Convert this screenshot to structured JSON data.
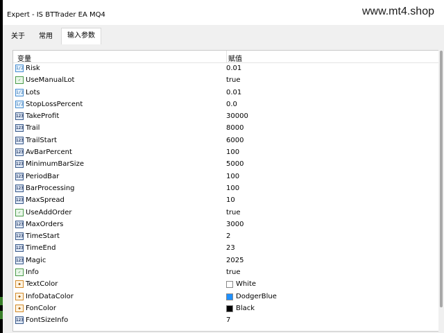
{
  "window": {
    "title": "Expert - IS BTTrader EA MQ4"
  },
  "watermark": "www.mt4.shop",
  "tabs": [
    {
      "label": "关于"
    },
    {
      "label": "常用"
    },
    {
      "label": "输入参数"
    }
  ],
  "grid": {
    "headers": {
      "name": "变量",
      "value": "赋值"
    },
    "rows": [
      {
        "name": "Risk",
        "value": "0.01",
        "type": "float"
      },
      {
        "name": "UseManualLot",
        "value": "true",
        "type": "bool"
      },
      {
        "name": "Lots",
        "value": "0.01",
        "type": "float"
      },
      {
        "name": "StopLossPercent",
        "value": "0.0",
        "type": "float"
      },
      {
        "name": "TakeProfit",
        "value": "30000",
        "type": "int"
      },
      {
        "name": "Trail",
        "value": "8000",
        "type": "int"
      },
      {
        "name": "TrailStart",
        "value": "6000",
        "type": "int"
      },
      {
        "name": "AvBarPercent",
        "value": "100",
        "type": "int"
      },
      {
        "name": "MinimumBarSize",
        "value": "5000",
        "type": "int"
      },
      {
        "name": "PeriodBar",
        "value": "100",
        "type": "int"
      },
      {
        "name": "BarProcessing",
        "value": "100",
        "type": "int"
      },
      {
        "name": "MaxSpread",
        "value": "10",
        "type": "int"
      },
      {
        "name": "UseAddOrder",
        "value": "true",
        "type": "bool"
      },
      {
        "name": "MaxOrders",
        "value": "3000",
        "type": "int"
      },
      {
        "name": "TimeStart",
        "value": "2",
        "type": "int"
      },
      {
        "name": "TimeEnd",
        "value": "23",
        "type": "int"
      },
      {
        "name": "Magic",
        "value": "2025",
        "type": "int"
      },
      {
        "name": "Info",
        "value": "true",
        "type": "bool"
      },
      {
        "name": "TextColor",
        "value": "White",
        "type": "color",
        "swatch": "#ffffff"
      },
      {
        "name": "InfoDataColor",
        "value": "DodgerBlue",
        "type": "color",
        "swatch": "#1e90ff"
      },
      {
        "name": "FonColor",
        "value": "Black",
        "type": "color",
        "swatch": "#000000"
      },
      {
        "name": "FontSizeInfo",
        "value": "7",
        "type": "int"
      }
    ]
  },
  "icon_glyphs": {
    "float": "1/2",
    "int": "123",
    "bool": "✓",
    "color": "◆"
  },
  "colors": {
    "tab_bg": "#f0f0f0",
    "grid_border": "#c8c8c8",
    "scroll_thumb": "#a8a8a8"
  }
}
